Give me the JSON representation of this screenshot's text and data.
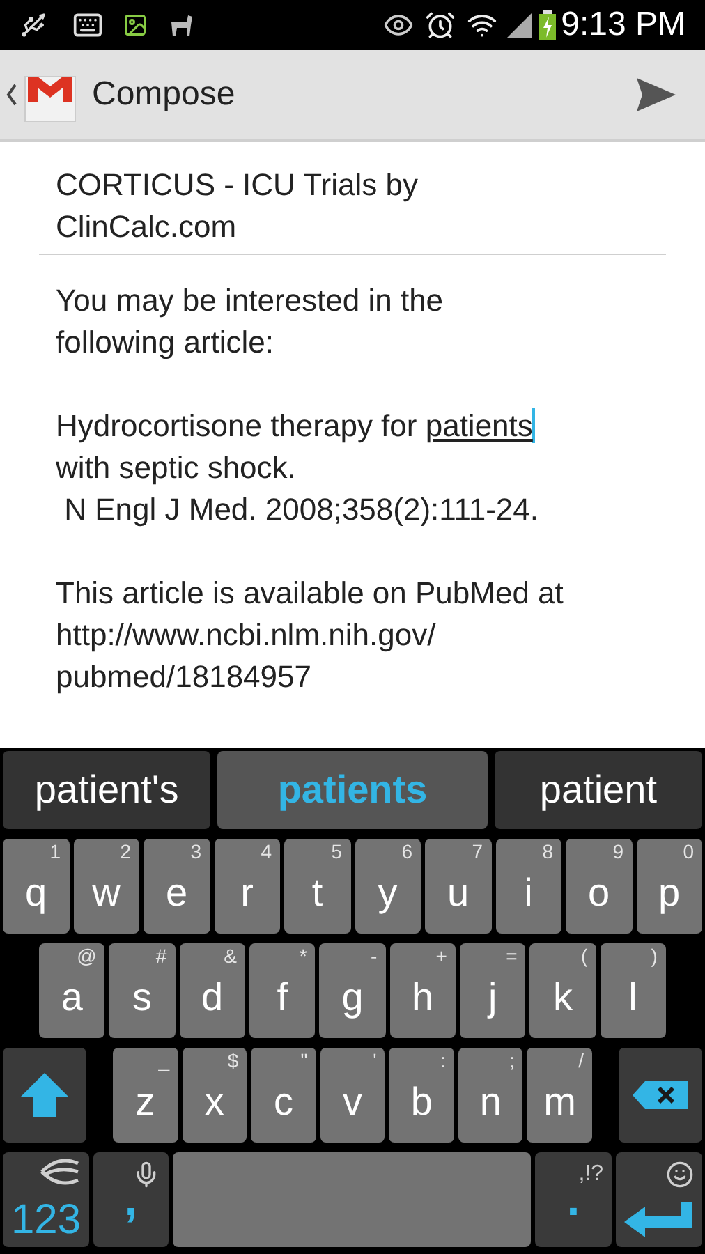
{
  "status_bar": {
    "time": "9:13 PM"
  },
  "action_bar": {
    "title": "Compose"
  },
  "subject": {
    "lines": [
      "CORTICUS - ICU Trials by",
      "ClinCalc.com"
    ]
  },
  "body": {
    "paragraphs": [
      {
        "lines": [
          {
            "text": "You may be interested in the"
          },
          {
            "text": "following article:"
          }
        ]
      },
      {
        "lines": [
          {
            "text": "Hydrocortisone therapy for ",
            "composing": "patients"
          },
          {
            "text": "with septic shock."
          },
          {
            "text": " N Engl J Med. 2008;358(2):111-24."
          }
        ]
      },
      {
        "lines": [
          {
            "text": "This article is available on PubMed at"
          },
          {
            "text": "http://www.ncbi.nlm.nih.gov/"
          },
          {
            "text": "pubmed/18184957"
          }
        ]
      }
    ]
  },
  "keyboard": {
    "suggestions": [
      {
        "text": "patient's",
        "selected": false
      },
      {
        "text": "patients",
        "selected": true
      },
      {
        "text": "patient",
        "selected": false
      }
    ],
    "rows": [
      [
        {
          "kind": "letter",
          "label": "q",
          "hint": "1"
        },
        {
          "kind": "letter",
          "label": "w",
          "hint": "2"
        },
        {
          "kind": "letter",
          "label": "e",
          "hint": "3"
        },
        {
          "kind": "letter",
          "label": "r",
          "hint": "4"
        },
        {
          "kind": "letter",
          "label": "t",
          "hint": "5"
        },
        {
          "kind": "letter",
          "label": "y",
          "hint": "6"
        },
        {
          "kind": "letter",
          "label": "u",
          "hint": "7"
        },
        {
          "kind": "letter",
          "label": "i",
          "hint": "8"
        },
        {
          "kind": "letter",
          "label": "o",
          "hint": "9"
        },
        {
          "kind": "letter",
          "label": "p",
          "hint": "0"
        }
      ],
      [
        {
          "kind": "letter",
          "label": "a",
          "hint": "@"
        },
        {
          "kind": "letter",
          "label": "s",
          "hint": "#"
        },
        {
          "kind": "letter",
          "label": "d",
          "hint": "&"
        },
        {
          "kind": "letter",
          "label": "f",
          "hint": "*"
        },
        {
          "kind": "letter",
          "label": "g",
          "hint": "-"
        },
        {
          "kind": "letter",
          "label": "h",
          "hint": "+"
        },
        {
          "kind": "letter",
          "label": "j",
          "hint": "="
        },
        {
          "kind": "letter",
          "label": "k",
          "hint": "("
        },
        {
          "kind": "letter",
          "label": "l",
          "hint": ")"
        }
      ],
      [
        {
          "kind": "shift"
        },
        {
          "kind": "letter",
          "label": "z",
          "hint": "_"
        },
        {
          "kind": "letter",
          "label": "x",
          "hint": "$"
        },
        {
          "kind": "letter",
          "label": "c",
          "hint": "\""
        },
        {
          "kind": "letter",
          "label": "v",
          "hint": "'"
        },
        {
          "kind": "letter",
          "label": "b",
          "hint": ":"
        },
        {
          "kind": "letter",
          "label": "n",
          "hint": ";"
        },
        {
          "kind": "letter",
          "label": "m",
          "hint": "/"
        },
        {
          "kind": "delete"
        }
      ],
      [
        {
          "kind": "symbols",
          "label": "123"
        },
        {
          "kind": "comma",
          "label": ","
        },
        {
          "kind": "space"
        },
        {
          "kind": "period",
          "label": ".",
          "hint": ",!?"
        },
        {
          "kind": "enter"
        }
      ]
    ]
  }
}
